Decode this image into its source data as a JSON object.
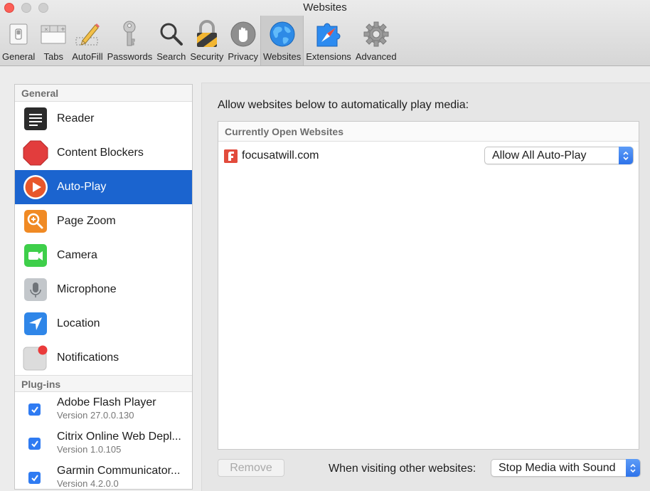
{
  "window": {
    "title": "Websites"
  },
  "toolbar": {
    "items": [
      {
        "label": "General",
        "icon": "general-switch-icon"
      },
      {
        "label": "Tabs",
        "icon": "tabs-icon"
      },
      {
        "label": "AutoFill",
        "icon": "pencil-icon"
      },
      {
        "label": "Passwords",
        "icon": "key-icon"
      },
      {
        "label": "Search",
        "icon": "magnifier-icon"
      },
      {
        "label": "Security",
        "icon": "padlock-icon"
      },
      {
        "label": "Privacy",
        "icon": "hand-icon"
      },
      {
        "label": "Websites",
        "icon": "globe-icon",
        "selected": true
      },
      {
        "label": "Extensions",
        "icon": "puzzle-compass-icon"
      },
      {
        "label": "Advanced",
        "icon": "gear-icon"
      }
    ]
  },
  "sidebar": {
    "general_header": "General",
    "items": [
      {
        "label": "Reader",
        "icon": "reader-icon"
      },
      {
        "label": "Content Blockers",
        "icon": "stop-sign-icon"
      },
      {
        "label": "Auto-Play",
        "icon": "play-icon",
        "selected": true
      },
      {
        "label": "Page Zoom",
        "icon": "zoom-icon"
      },
      {
        "label": "Camera",
        "icon": "camera-icon"
      },
      {
        "label": "Microphone",
        "icon": "microphone-icon"
      },
      {
        "label": "Location",
        "icon": "location-arrow-icon"
      },
      {
        "label": "Notifications",
        "icon": "notifications-icon"
      }
    ],
    "plugins_header": "Plug-ins",
    "plugins": [
      {
        "name": "Adobe Flash Player",
        "version": "Version 27.0.0.130",
        "checked": true
      },
      {
        "name": "Citrix Online Web Depl...",
        "version": "Version 1.0.105",
        "checked": true
      },
      {
        "name": "Garmin Communicator...",
        "version": "Version 4.2.0.0",
        "checked": true
      }
    ]
  },
  "main": {
    "prompt": "Allow websites below to automatically play media:",
    "open_sites_header": "Currently Open Websites",
    "sites": [
      {
        "name": "focusatwill.com",
        "setting": "Allow All Auto-Play"
      }
    ],
    "remove_label": "Remove",
    "other_label": "When visiting other websites:",
    "other_setting": "Stop Media with Sound"
  },
  "colors": {
    "selection": "#1b64cf",
    "checkbox": "#2f7bf2",
    "close_button": "#fc5f57"
  }
}
